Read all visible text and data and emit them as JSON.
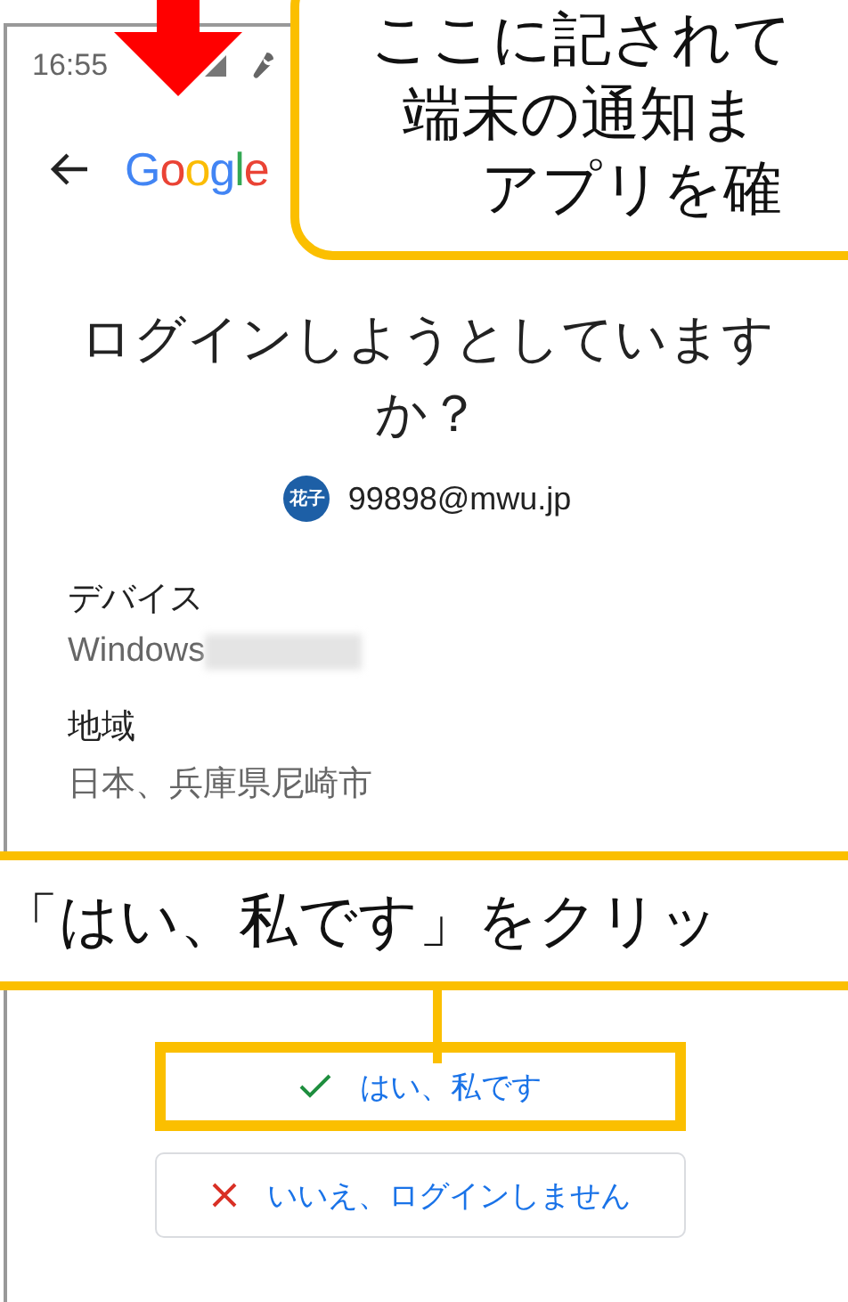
{
  "status_bar": {
    "time": "16:55"
  },
  "header": {
    "logo": "Google"
  },
  "title": "ログインしようとしていますか？",
  "account": {
    "avatar": "花子",
    "email": "99898@mwu.jp"
  },
  "details": [
    {
      "label": "デバイス",
      "value": "Windows",
      "blurred": true
    },
    {
      "label": "地域",
      "value": "日本、兵庫県尼崎市",
      "blurred": false
    }
  ],
  "buttons": [
    {
      "kind": "confirm",
      "label": "はい、私です",
      "highlighted": true
    },
    {
      "kind": "deny",
      "label": "いいえ、ログインしません",
      "highlighted": false
    }
  ],
  "callouts": [
    {
      "kind": "top",
      "lines": [
        "ここに記されて",
        "端末の通知ま",
        "アプリを確"
      ]
    },
    {
      "kind": "band",
      "lines": [
        "「はい、私です」をクリッ"
      ]
    }
  ]
}
